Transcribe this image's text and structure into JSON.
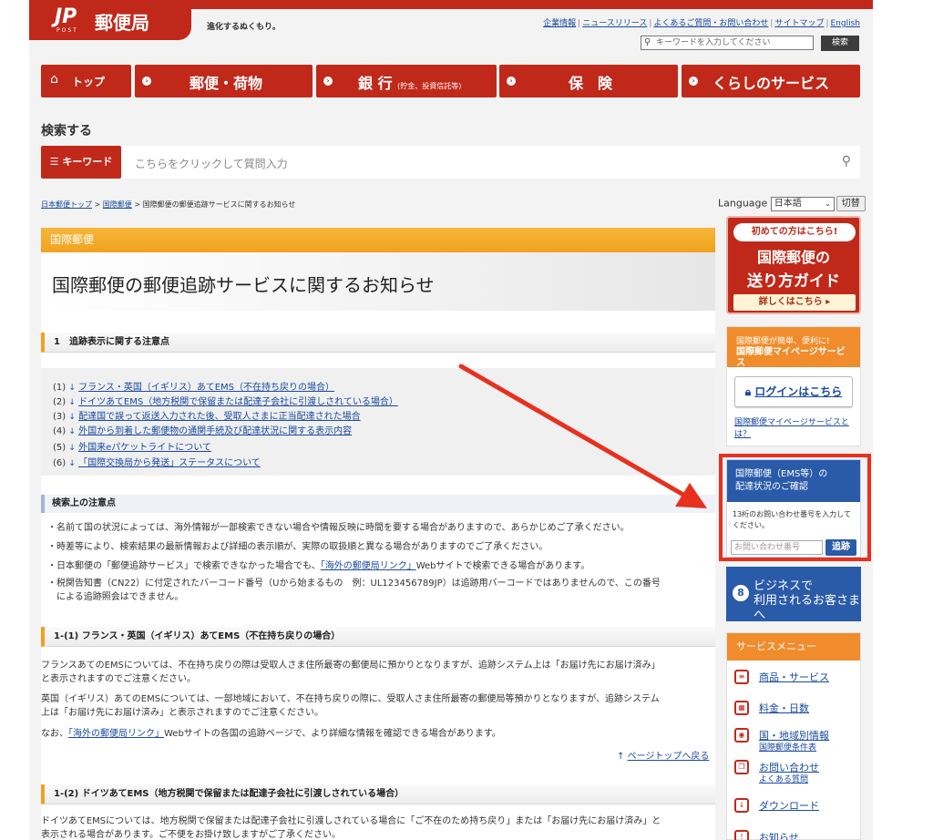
{
  "header": {
    "logo_mark": "JP",
    "logo_sub": "POST",
    "logo_name": "郵便局",
    "tagline": "進化するぬくもり。",
    "links": [
      "企業情報",
      "ニュースリリース",
      "よくあるご質問・お問い合わせ",
      "サイトマップ",
      "English"
    ],
    "search_placeholder": "キーワードを入力してください",
    "search_button": "検索"
  },
  "nav": {
    "top": "トップ",
    "mail": "郵便・荷物",
    "bank": "銀 行",
    "bank_sub": "(貯金、投資信託等)",
    "insurance": "保　険",
    "life": "くらしのサービス"
  },
  "search_section": {
    "heading": "検索する",
    "keyword_button": "キーワード",
    "placeholder": "こちらをクリックして質問入力"
  },
  "breadcrumb": {
    "home": "日本郵便トップ",
    "sep": " > ",
    "intl": "国際郵便",
    "current": "国際郵便の郵便追跡サービスに関するお知らせ"
  },
  "language": {
    "label": "Language",
    "selected": "日本語",
    "button": "切替"
  },
  "main": {
    "category": "国際郵便",
    "title": "国際郵便の郵便追跡サービスに関するお知らせ",
    "section1": "1　追跡表示に関する注意点",
    "links": [
      {
        "num": "(1)",
        "text": "フランス・英国（イギリス）あてEMS（不在持ち戻りの場合）"
      },
      {
        "num": "(2)",
        "text": "ドイツあてEMS（地方税関で保留または配達子会社に引渡しされている場合）"
      },
      {
        "num": "(3)",
        "text": "配達国で誤って返送入力された後、受取人さまに正当配達された場合"
      },
      {
        "num": "(4)",
        "text": "外国から到着した郵便物の通関手続及び配達状況に関する表示内容"
      },
      {
        "num": "(5)",
        "text": "外国来eパケットライトについて"
      },
      {
        "num": "(6)",
        "text": "「国際交換局から発送」ステータスについて"
      }
    ],
    "notes_heading": "検索上の注意点",
    "notes": [
      "名前て国の状況によっては、海外情報が一部検索できない場合や情報反映に時間を要する場合がありますので、あらかじめご了承ください。",
      "時差等により、検索結果の最新情報および詳細の表示順が、実際の取扱順と異なる場合がありますのでご了承ください。",
      "日本郵便の「郵便追跡サービス」で検索できなかった場合でも、「海外の郵便局リンク」Webサイトで検索できる場合があります。",
      "税関告知書（CN22）に付定されたバーコード番号（Uから始まるもの　例：UL123456789JP）は追跡用バーコードではありませんので、この番号",
      "による追跡照会はできません。"
    ],
    "note3_pre": "日本郵便の「郵便追跡サービス」で検索できなかった場合でも、",
    "note3_link": "「海外の郵便局リンク」",
    "note3_post": "Webサイトで検索できる場合があります。",
    "section1_1": "1-(1)  フランス・英国（イギリス）あてEMS（不在持ち戻りの場合）",
    "p1_l1": "フランスあてのEMSについては、不在持ち戻りの際は受取人さま住所最寄の郵便局に預かりとなりますが、追跡システム上は「お届け先にお届け済み」",
    "p1_l2": "と表示されますのでご注意ください。",
    "p2_l1": "英国（イギリス）あてのEMSについては、一部地域において、不在持ち戻りの際に、受取人さま住所最寄の郵便局等預かりとなりますが、追跡システム",
    "p2_l2": "上は「お届け先にお届け済み」と表示されますのでご注意ください。",
    "p3_pre": "なお、",
    "p3_link": "「海外の郵便局リンク」",
    "p3_post": "Webサイトの各国の追跡ページで、より詳細な情報を確認できる場合があります。",
    "pagetop": "ページトップへ戻る",
    "section1_2": "1-(2)  ドイツあてEMS（地方税関で保留または配達子会社に引渡しされている場合）",
    "p4_l1": "ドイツあてEMSについては、地方税関で保留または配達子会社に引渡しされている場合に「ご不在のため持ち戻り」または「お届け先にお届け済み」と",
    "p4_l2": "表示される場合があります。ご不便をお掛け致しますがご了承ください。"
  },
  "sidebar": {
    "guide_top": "初めての方はこちら!",
    "guide_l1": "国際郵便の",
    "guide_l2": "送り方ガイド",
    "guide_more": "詳しくはこちら",
    "mypage_l1": "国際郵便が簡単、便利に!",
    "mypage_l2": "国際郵便マイページサービス",
    "login": "ログインはこちら",
    "mypage_link": "国際郵便マイページサービスとは？",
    "track_title_l1": "国際郵便（EMS等）の",
    "track_title_l2": "配達状況のご確認",
    "track_desc": "13桁のお問い合わせ番号を入力してください。",
    "track_placeholder": "お問い合わせ番号",
    "track_button": "追跡",
    "biz_l1": "ビジネスで",
    "biz_l2": "利用されるお客さまへ",
    "svc_heading": "サービスメニュー",
    "svc_items": [
      {
        "t": "商品・サービス",
        "s": ""
      },
      {
        "t": "料金・日数",
        "s": ""
      },
      {
        "t": "国・地域別情報",
        "s": "国際郵便条件表"
      },
      {
        "t": "お問い合わせ",
        "s": "よくある質問"
      },
      {
        "t": "ダウンロード",
        "s": ""
      },
      {
        "t": "お知らせ",
        "s": ""
      }
    ]
  },
  "colors": {
    "brand_red": "#c0291a",
    "orange": "#f0a21f",
    "blue": "#2a5ba8",
    "annotation": "#e8301f"
  }
}
